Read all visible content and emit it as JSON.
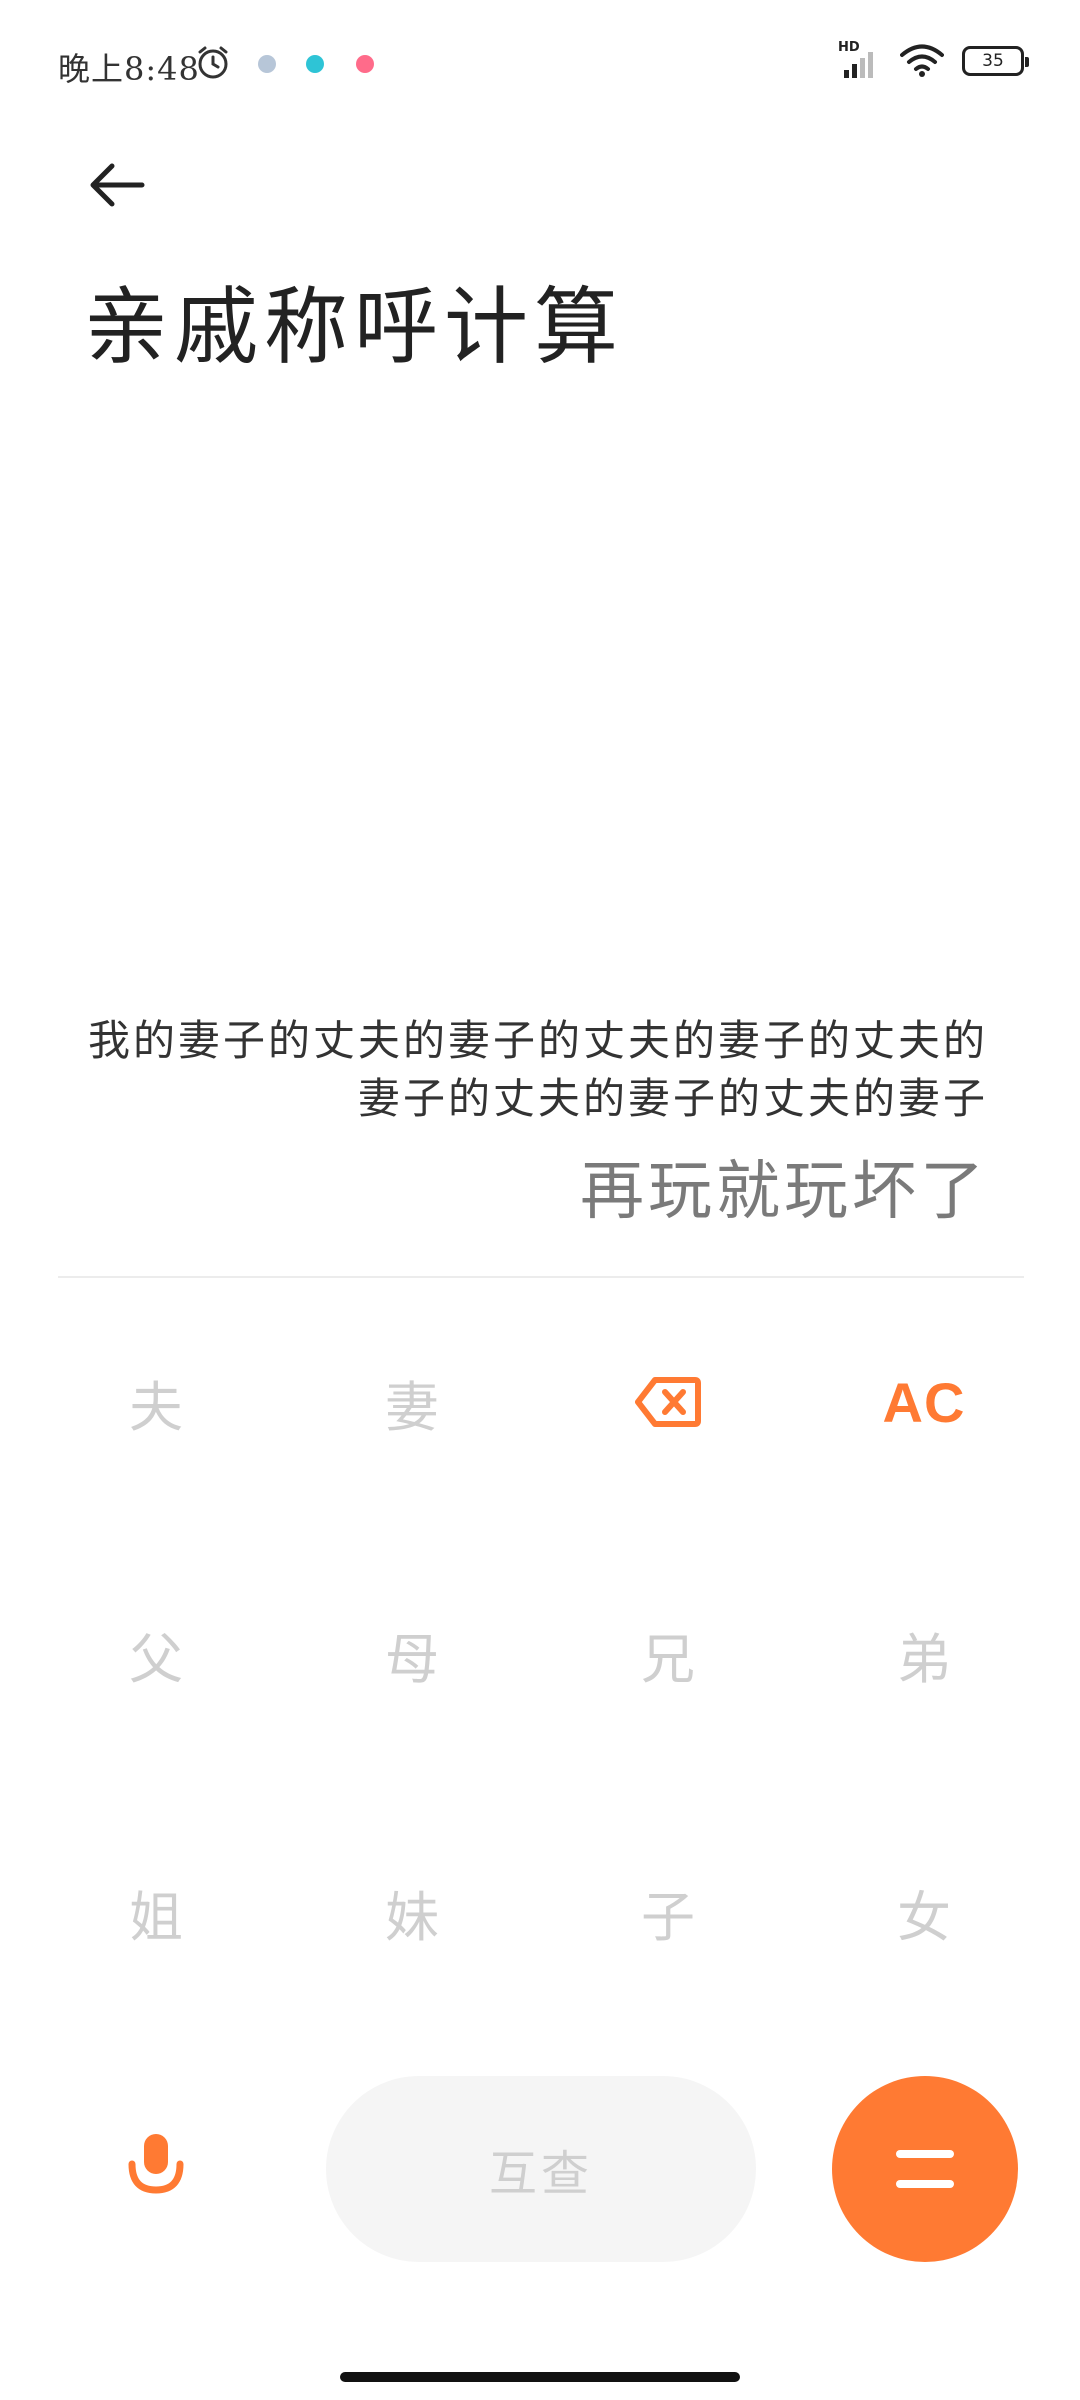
{
  "status_bar": {
    "time": "晚上8:48",
    "hd_label": "HD",
    "battery": "35",
    "colors": {
      "notif_1": "#b7c6d8",
      "notif_2": "#2ec4d6",
      "notif_3": "#ff6b8a"
    }
  },
  "header": {
    "title": "亲戚称呼计算"
  },
  "display": {
    "expression": "我的妻子的丈夫的妻子的丈夫的妻子的丈夫的妻子的丈夫的妻子的丈夫的妻子",
    "result": "再玩就玩坏了"
  },
  "keypad": {
    "row1": {
      "k1": "夫",
      "k2": "妻",
      "ac": "AC"
    },
    "row2": {
      "k1": "父",
      "k2": "母",
      "k3": "兄",
      "k4": "弟"
    },
    "row3": {
      "k1": "姐",
      "k2": "妹",
      "k3": "子",
      "k4": "女"
    }
  },
  "actions": {
    "mutual": "互查"
  },
  "colors": {
    "accent": "#ff7a33",
    "key_text": "#cfcfcf",
    "pill_bg": "#f5f5f5"
  }
}
